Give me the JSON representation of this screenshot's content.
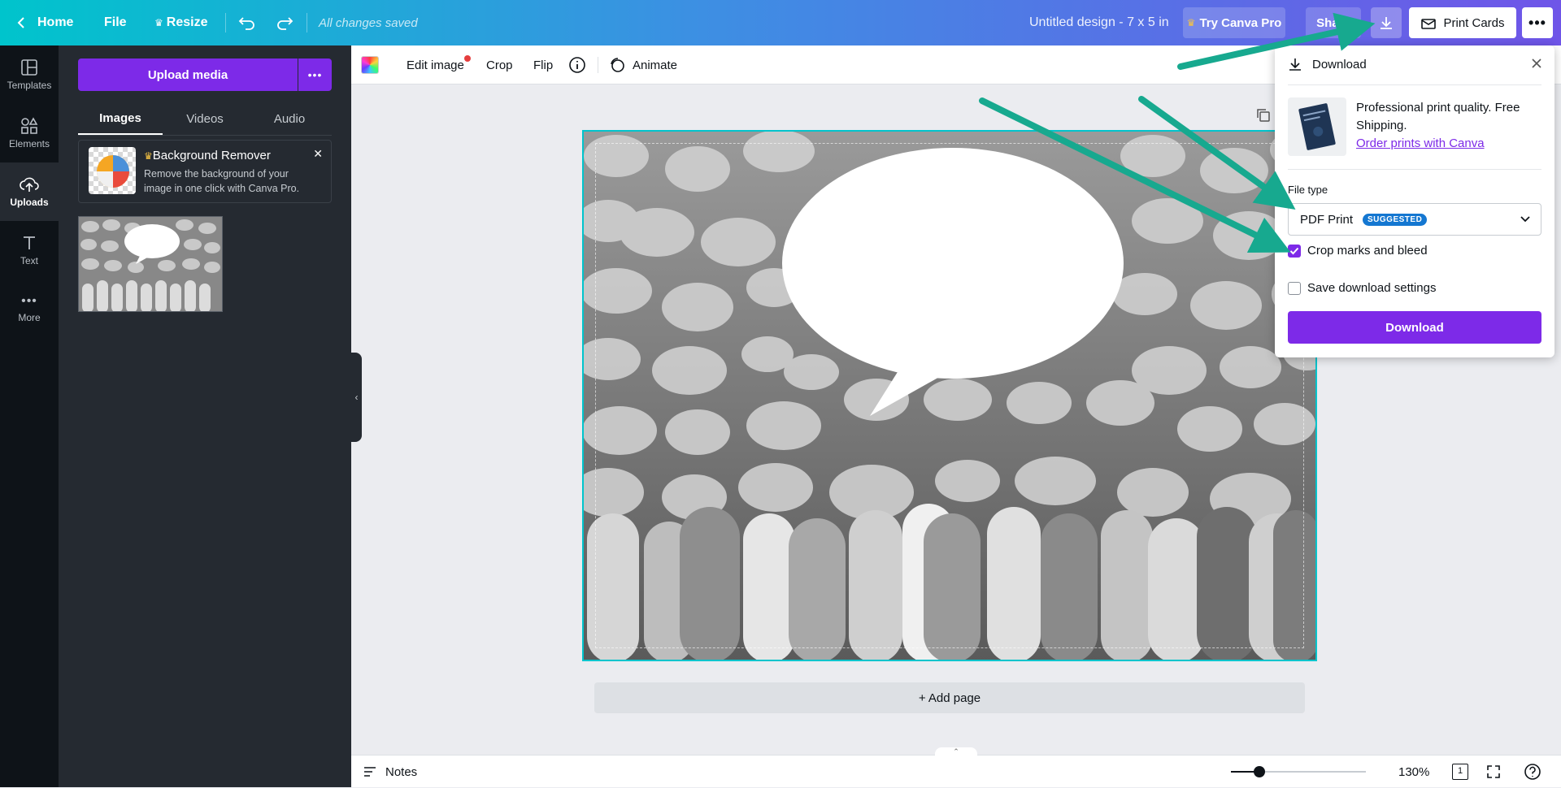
{
  "topbar": {
    "home": "Home",
    "file": "File",
    "resize": "Resize",
    "saved_status": "All changes saved",
    "design_title": "Untitled design - 7 x 5 in",
    "try_pro": "Try Canva Pro",
    "share": "Share",
    "print_cards": "Print Cards"
  },
  "rail": {
    "items": [
      {
        "label": "Templates",
        "icon": "templates-icon"
      },
      {
        "label": "Elements",
        "icon": "elements-icon"
      },
      {
        "label": "Uploads",
        "icon": "uploads-icon"
      },
      {
        "label": "Text",
        "icon": "text-icon"
      },
      {
        "label": "More",
        "icon": "more-icon"
      }
    ],
    "active": "Uploads"
  },
  "panel": {
    "upload_button": "Upload media",
    "tabs": [
      "Images",
      "Videos",
      "Audio"
    ],
    "active_tab": "Images",
    "promo": {
      "title": "Background Remover",
      "description": "Remove the background of your image in one click with Canva Pro."
    }
  },
  "context_toolbar": {
    "edit_image": "Edit image",
    "crop": "Crop",
    "flip": "Flip",
    "animate": "Animate"
  },
  "canvas": {
    "add_page": "+ Add page"
  },
  "bottombar": {
    "notes": "Notes",
    "zoom": "130%",
    "page_count": "1"
  },
  "download_panel": {
    "title": "Download",
    "print_text": "Professional print quality. Free Shipping.",
    "print_link": "Order prints with Canva",
    "file_type_label": "File type",
    "file_type_value": "PDF Print",
    "suggested_badge": "SUGGESTED",
    "crop_marks_label": "Crop marks and bleed",
    "crop_marks_checked": true,
    "save_settings_label": "Save download settings",
    "save_settings_checked": false,
    "download_button": "Download"
  },
  "colors": {
    "accent_purple": "#7d2ae8",
    "arrow_teal": "#17a98f",
    "selection_cyan": "#00c4cc"
  }
}
